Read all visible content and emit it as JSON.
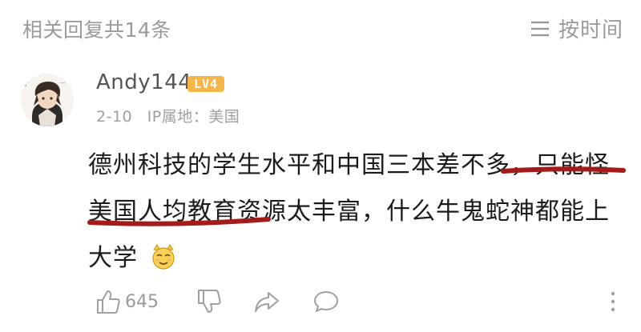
{
  "header": {
    "replies_count": "相关回复共14条",
    "sort_label": "按时间",
    "sort_icon": "list-sort-icon"
  },
  "comment": {
    "avatar_icon": "anime-avatar",
    "username": "Andy144",
    "level": "LV4",
    "date": "2-10",
    "ip_location": "IP属地：美国",
    "text_before_emoji": "德州科技的学生水平和中国三本差不多，只能怪美国人均教育资源太丰富，什么牛鬼蛇神都能上大学",
    "emoji_icon": "smirk-cat-emoji",
    "underline_color": "#a51b1b"
  },
  "actions": {
    "like_count": "645",
    "like_icon": "thumbs-up-icon",
    "dislike_icon": "thumbs-down-icon",
    "share_icon": "share-arrow-icon",
    "reply_icon": "comment-bubble-icon",
    "more_icon": "more-vertical-icon"
  }
}
